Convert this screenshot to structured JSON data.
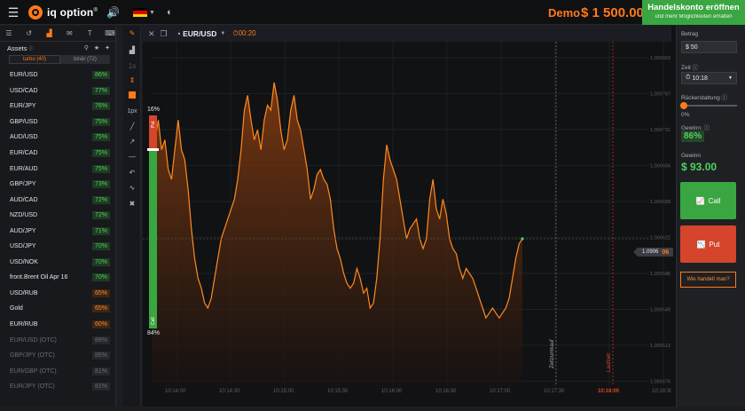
{
  "topbar": {
    "logo": "iq option",
    "logo_mark": "®",
    "demo_label": "Demo",
    "balance": "$ 1 500.00",
    "open_account_title": "Handelskonto eröffnen",
    "open_account_sub": "und mehr Möglichkeiten erhalten"
  },
  "assets_panel": {
    "title": "Assets",
    "tabs": [
      "turbo (40)",
      "binär (72)"
    ],
    "items": [
      {
        "name": "EUR/USD",
        "pct": "86%",
        "tone": "g"
      },
      {
        "name": "USD/CAD",
        "pct": "77%",
        "tone": "g"
      },
      {
        "name": "EUR/JPY",
        "pct": "76%",
        "tone": "g"
      },
      {
        "name": "GBP/USD",
        "pct": "75%",
        "tone": "g"
      },
      {
        "name": "AUD/USD",
        "pct": "75%",
        "tone": "g"
      },
      {
        "name": "EUR/CAD",
        "pct": "75%",
        "tone": "g"
      },
      {
        "name": "EUR/AUD",
        "pct": "75%",
        "tone": "g"
      },
      {
        "name": "GBP/JPY",
        "pct": "73%",
        "tone": "g"
      },
      {
        "name": "AUD/CAD",
        "pct": "72%",
        "tone": "g"
      },
      {
        "name": "NZD/USD",
        "pct": "72%",
        "tone": "g"
      },
      {
        "name": "AUD/JPY",
        "pct": "71%",
        "tone": "g"
      },
      {
        "name": "USD/JPY",
        "pct": "70%",
        "tone": "g"
      },
      {
        "name": "USD/NOK",
        "pct": "70%",
        "tone": "g"
      },
      {
        "name": "front.Brent Oil Apr 16",
        "pct": "70%",
        "tone": "g"
      },
      {
        "name": "USD/RUB",
        "pct": "65%",
        "tone": "o"
      },
      {
        "name": "Gold",
        "pct": "65%",
        "tone": "o"
      },
      {
        "name": "EUR/RUB",
        "pct": "60%",
        "tone": "o"
      },
      {
        "name": "EUR/USD (OTC)",
        "pct": "88%",
        "tone": "d"
      },
      {
        "name": "GBP/JPY (OTC)",
        "pct": "85%",
        "tone": "d"
      },
      {
        "name": "EUR/GBP (OTC)",
        "pct": "81%",
        "tone": "d"
      },
      {
        "name": "EUR/JPY (OTC)",
        "pct": "81%",
        "tone": "d"
      }
    ]
  },
  "tools": {
    "linewidth": "1px"
  },
  "chart_header": {
    "pair": "EUR/USD",
    "timer": "00:20"
  },
  "sentiment": {
    "put_pct": "16%",
    "call_pct": "84%",
    "put_label": "Put",
    "call_label": "Call"
  },
  "chart": {
    "price_tag_main": "1.0906",
    "price_tag_hl": "06",
    "purchase_label": "Zeitzumkauf",
    "expiry_label": "Laufzeit",
    "x_ticks": [
      "10:14:00",
      "10:14:30",
      "10:15:00",
      "10:15:30",
      "10:16:00",
      "10:16:30",
      "10:17:00",
      "10:17:30",
      "10:18:00",
      "10:18:30"
    ],
    "y_ticks": [
      "1.000803",
      "1.000767",
      "1.000731",
      "1.000694",
      "1.000658",
      "1.000622",
      "1.000586",
      "1.000549",
      "1.000513",
      "1.000476"
    ]
  },
  "chart_data": {
    "type": "area",
    "title": "",
    "xlabel": "",
    "ylabel": "",
    "ylim": [
      1.000476,
      1.000803
    ],
    "series": [
      {
        "values": [
          0.000595,
          0.000718,
          0.00074,
          0.00071,
          0.00072,
          0.00069,
          0.00068,
          0.00071,
          0.00074,
          0.00071,
          0.0007,
          0.00067,
          0.00063,
          0.0006,
          0.00058,
          0.00057,
          0.000555,
          0.00055,
          0.00056,
          0.00058,
          0.0006,
          0.00062,
          0.00063,
          0.00064,
          0.00065,
          0.00066,
          0.00068,
          0.00071,
          0.00075,
          0.000765,
          0.00074,
          0.00072,
          0.00073,
          0.00071,
          0.00074,
          0.000755,
          0.00075,
          0.000778,
          0.00076,
          0.00073,
          0.00071,
          0.00072,
          0.00075,
          0.000765,
          0.00074,
          0.00073,
          0.00071,
          0.00069,
          0.00066,
          0.00067,
          0.000685,
          0.00069,
          0.00068,
          0.000675,
          0.00066,
          0.00063,
          0.00061,
          0.0006,
          0.000585,
          0.000575,
          0.00057,
          0.000575,
          0.00059,
          0.00058,
          0.000565,
          0.00057,
          0.00055,
          0.000555,
          0.00058,
          0.00062,
          0.00068,
          0.000715,
          0.0007,
          0.00069,
          0.00068,
          0.00066,
          0.00064,
          0.00062,
          0.00063,
          0.000635,
          0.00064,
          0.00062,
          0.00061,
          0.00062,
          0.00066,
          0.00068,
          0.00065,
          0.00064,
          0.00066,
          0.000645,
          0.00062,
          0.00061,
          0.000605,
          0.00059,
          0.00058,
          0.00059,
          0.000585,
          0.00058,
          0.00057,
          0.00056,
          0.00055,
          0.00054,
          0.000545,
          0.00055,
          0.000545,
          0.00054,
          0.000545,
          0.00055,
          0.00056,
          0.00058,
          0.0006,
          0.000615,
          0.00062
        ]
      }
    ]
  },
  "rightpanel": {
    "betrag_label": "Betrag",
    "betrag_value": "$ 50",
    "zeit_label": "Zeit",
    "zeit_value": "10:18",
    "refund_label": "Rückerstattung",
    "refund_value": "0%",
    "gain_label": "Gewinn:",
    "gain_pct": "86%",
    "payout_label": "Gewinn",
    "payout_value": "$ 93.00",
    "call_label": "Call",
    "put_label": "Put",
    "how_label": "Wie handelt man?"
  },
  "colors": {
    "accent": "#ff7a1a",
    "green": "#3aa641",
    "red": "#d4452c",
    "bg": "#111214"
  }
}
